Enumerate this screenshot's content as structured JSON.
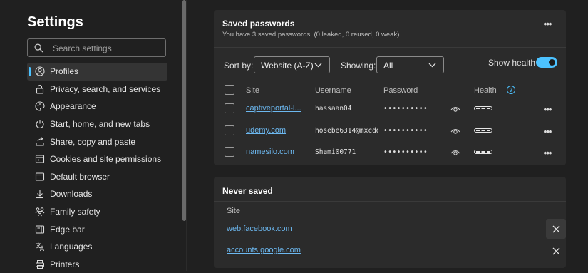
{
  "sidebar": {
    "title": "Settings",
    "search_placeholder": "Search settings",
    "items": [
      {
        "label": "Profiles",
        "icon": "profile-icon",
        "active": true
      },
      {
        "label": "Privacy, search, and services",
        "icon": "lock-icon"
      },
      {
        "label": "Appearance",
        "icon": "palette-icon"
      },
      {
        "label": "Start, home, and new tabs",
        "icon": "power-icon"
      },
      {
        "label": "Share, copy and paste",
        "icon": "share-icon"
      },
      {
        "label": "Cookies and site permissions",
        "icon": "cookie-icon"
      },
      {
        "label": "Default browser",
        "icon": "browser-icon"
      },
      {
        "label": "Downloads",
        "icon": "download-icon"
      },
      {
        "label": "Family safety",
        "icon": "family-icon"
      },
      {
        "label": "Edge bar",
        "icon": "edge-bar-icon"
      },
      {
        "label": "Languages",
        "icon": "language-icon"
      },
      {
        "label": "Printers",
        "icon": "printer-icon"
      }
    ]
  },
  "saved_passwords": {
    "title": "Saved passwords",
    "subtitle": "You have 3 saved passwords. (0 leaked, 0 reused, 0 weak)",
    "sort_label": "Sort by:",
    "sort_value": "Website (A-Z)",
    "showing_label": "Showing:",
    "showing_value": "All",
    "show_health_label": "Show health",
    "show_health_on": true,
    "columns": {
      "site": "Site",
      "username": "Username",
      "password": "Password",
      "health": "Health"
    },
    "rows": [
      {
        "site": "captiveportal-l...",
        "username": "hassaan04",
        "password": "••••••••••"
      },
      {
        "site": "udemy.com",
        "username": "hosebe6314@mxcdd",
        "password": "••••••••••"
      },
      {
        "site": "namesilo.com",
        "username": "Shami00771",
        "password": "••••••••••"
      }
    ]
  },
  "never_saved": {
    "title": "Never saved",
    "column_site": "Site",
    "sites": [
      "web.facebook.com",
      "accounts.google.com"
    ]
  },
  "colors": {
    "accent": "#4cc2ff",
    "link": "#6cb8f0",
    "background": "#202020",
    "card": "#2b2b2b"
  }
}
